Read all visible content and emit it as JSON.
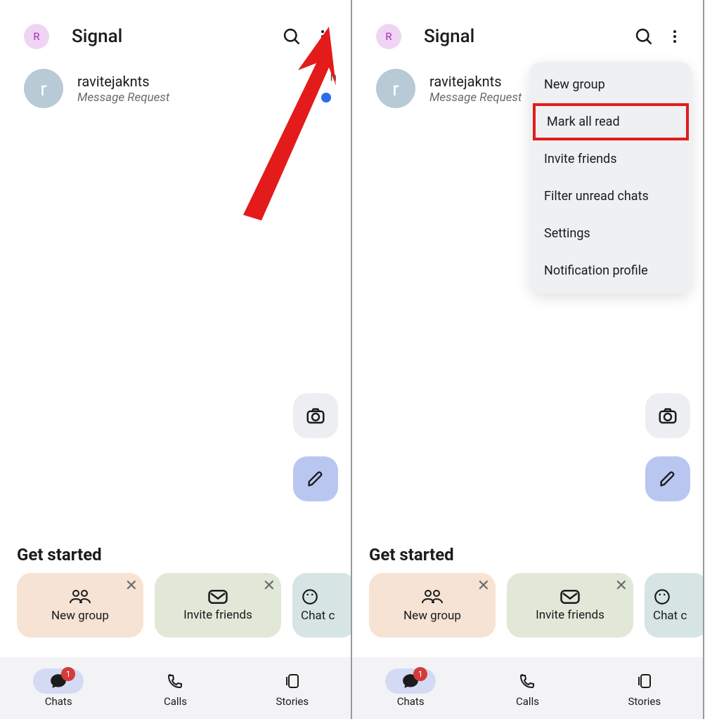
{
  "app": {
    "title": "Signal",
    "profile_initial": "R"
  },
  "chat": {
    "name": "ravitejaknts",
    "subtitle": "Message Request",
    "avatar_initial": "r",
    "time_peek": "h"
  },
  "get_started": {
    "title": "Get started",
    "cards": {
      "new_group": "New group",
      "invite": "Invite friends",
      "chat": "Chat c"
    }
  },
  "nav": {
    "chats": "Chats",
    "calls": "Calls",
    "stories": "Stories",
    "badge": "1"
  },
  "menu": {
    "items": [
      "New group",
      "Mark all read",
      "Invite friends",
      "Filter unread chats",
      "Settings",
      "Notification profile"
    ]
  }
}
